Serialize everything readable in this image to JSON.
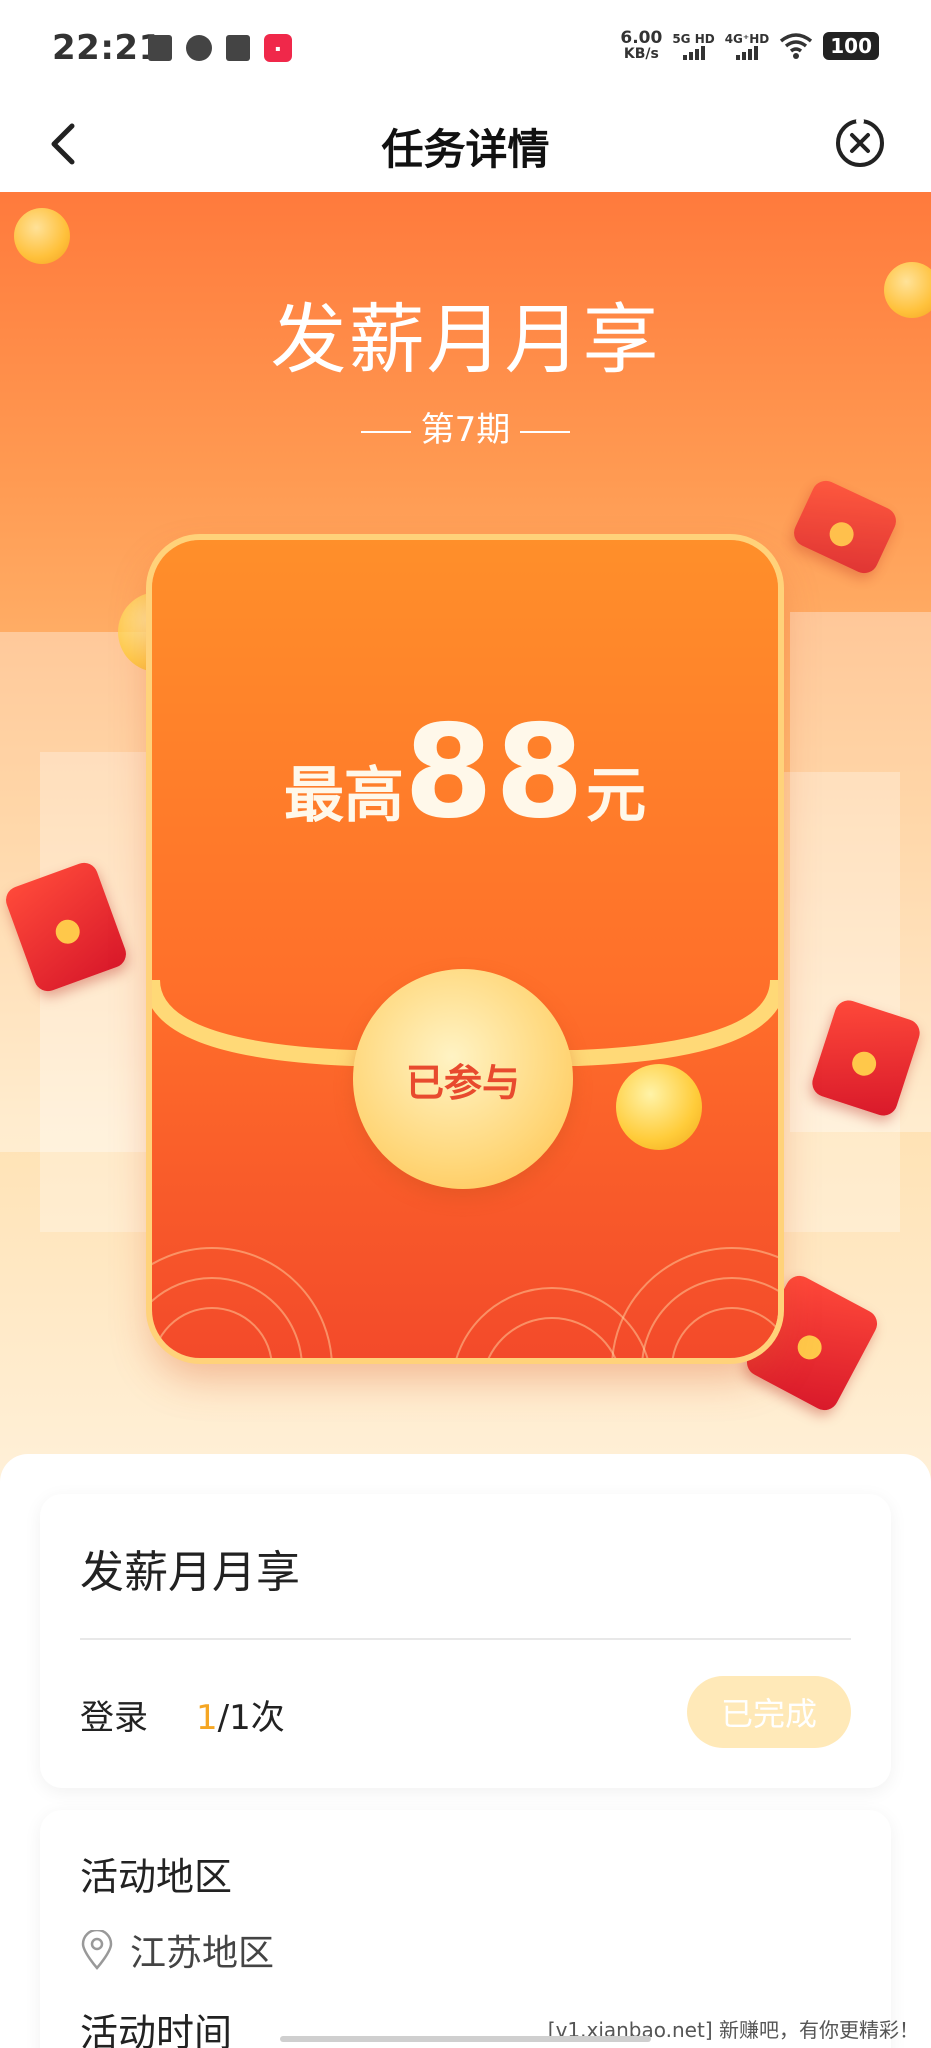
{
  "status_bar": {
    "time": "22:21",
    "speed_value": "6.00",
    "speed_unit": "KB/s",
    "net1": "5G HD",
    "net2": "4G⁺HD",
    "battery": "100"
  },
  "nav": {
    "title": "任务详情"
  },
  "hero": {
    "title": "发薪月月享",
    "period": "第7期",
    "amount_prefix": "最高",
    "amount_value": "88",
    "amount_suffix": "元",
    "join_label": "已参与"
  },
  "task_card": {
    "title": "发薪月月享",
    "task_label": "登录",
    "progress_done": "1",
    "progress_rest": "/1次",
    "status_button": "已完成"
  },
  "info_card": {
    "area_title": "活动地区",
    "area_value": "江苏地区",
    "time_title": "活动时间"
  },
  "watermark": "[v1.xianbao.net] 新赚吧，有你更精彩！"
}
